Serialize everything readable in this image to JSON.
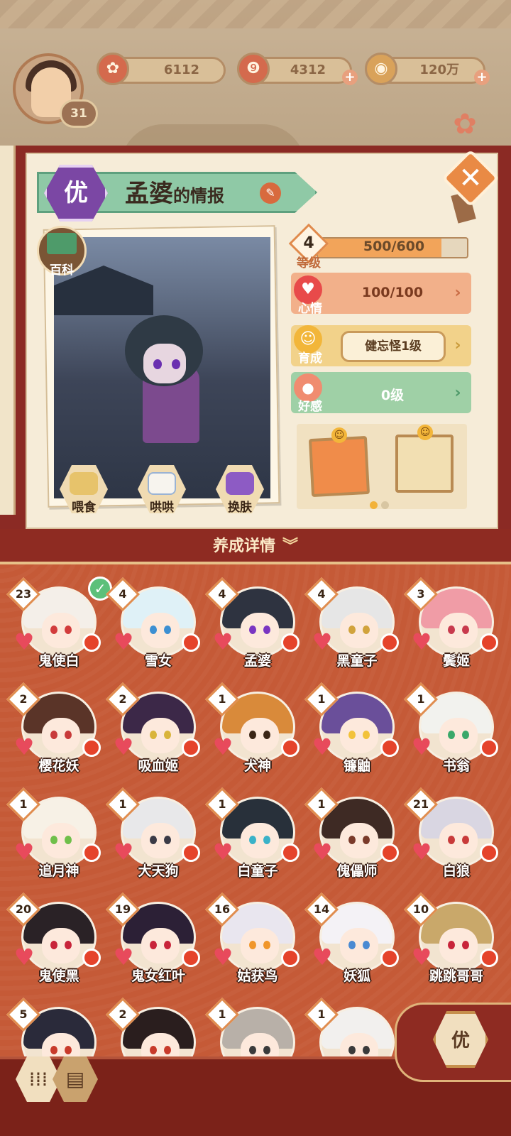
{
  "player": {
    "level": "31"
  },
  "resources": [
    {
      "name": "plum-blossom",
      "value": "6112"
    },
    {
      "name": "magatama",
      "value": "4312"
    },
    {
      "name": "coin",
      "value": "120万"
    }
  ],
  "info": {
    "rank": "优",
    "name": "孟婆",
    "title_suffix": "的情报",
    "baike_label": "百科",
    "actions": [
      "喂食",
      "哄哄",
      "换肤"
    ],
    "level": {
      "label": "等级",
      "value": "4",
      "progress": "500/600",
      "progress_fraction": 0.83
    },
    "mood": {
      "label": "心情",
      "value": "100/100"
    },
    "growth": {
      "label": "育成",
      "value": "健忘怪1级"
    },
    "affection": {
      "label": "好感",
      "value": "0级"
    },
    "pagination": {
      "pages": 2,
      "active": 1
    }
  },
  "grid": {
    "header": "养成详情",
    "characters": [
      {
        "name": "鬼使白",
        "level": "23",
        "checked": true,
        "hair": "#f4efe9",
        "eye": "#d23c3c"
      },
      {
        "name": "雪女",
        "level": "4",
        "hair": "#dff1f7",
        "eye": "#3c8fd2"
      },
      {
        "name": "孟婆",
        "level": "4",
        "hair": "#2e3340",
        "eye": "#7a35c2"
      },
      {
        "name": "黑童子",
        "level": "4",
        "hair": "#e6e6e6",
        "eye": "#d1a33c"
      },
      {
        "name": "鬓姬",
        "level": "3",
        "hair": "#f09ca6",
        "eye": "#c83a4d"
      },
      {
        "name": "樱花妖",
        "level": "2",
        "hair": "#5a3428",
        "eye": "#c83a3a"
      },
      {
        "name": "吸血姬",
        "level": "2",
        "hair": "#3c2848",
        "eye": "#d9b43a"
      },
      {
        "name": "犬神",
        "level": "1",
        "hair": "#d98a3a",
        "eye": "#3a2515"
      },
      {
        "name": "镰鼬",
        "level": "1",
        "hair": "#6a4f9a",
        "eye": "#f2c23a"
      },
      {
        "name": "书翁",
        "level": "1",
        "hair": "#f2f2ee",
        "eye": "#3aa86a"
      },
      {
        "name": "追月神",
        "level": "1",
        "hair": "#f7f1e6",
        "eye": "#6fbf4a"
      },
      {
        "name": "大天狗",
        "level": "1",
        "hair": "#e8e8ea",
        "eye": "#3a3a46"
      },
      {
        "name": "白童子",
        "level": "1",
        "hair": "#28303a",
        "eye": "#3ab2c8"
      },
      {
        "name": "傀儡师",
        "level": "1",
        "hair": "#3e2a24",
        "eye": "#7a3a2a"
      },
      {
        "name": "白狼",
        "level": "21",
        "hair": "#d9d6e2",
        "eye": "#c83a3a"
      },
      {
        "name": "鬼使黑",
        "level": "20",
        "hair": "#2a2226",
        "eye": "#c8243a"
      },
      {
        "name": "鬼女红叶",
        "level": "19",
        "hair": "#2c2036",
        "eye": "#c8243a"
      },
      {
        "name": "姑获鸟",
        "level": "16",
        "hair": "#e9e6ef",
        "eye": "#f0962a"
      },
      {
        "name": "妖狐",
        "level": "14",
        "hair": "#f4f2f6",
        "eye": "#4a8ad2"
      },
      {
        "name": "跳跳哥哥",
        "level": "10",
        "hair": "#c9a86a",
        "eye": "#c8243a"
      },
      {
        "name": "",
        "level": "5",
        "hair": "#2a2a3a",
        "eye": "#c83a2a"
      },
      {
        "name": "",
        "level": "2",
        "hair": "#2a1e1e",
        "eye": "#c83a2a"
      },
      {
        "name": "",
        "level": "1",
        "hair": "#b8b0a8",
        "eye": "#3a3a3a"
      },
      {
        "name": "",
        "level": "1",
        "hair": "#f2f0ee",
        "eye": "#3a3a3a"
      }
    ]
  },
  "bottom": {
    "rank_filter": "优"
  },
  "colors": {
    "accent": "#c55a37",
    "header": "#8e2b22",
    "rank_purple": "#7b47a4"
  }
}
